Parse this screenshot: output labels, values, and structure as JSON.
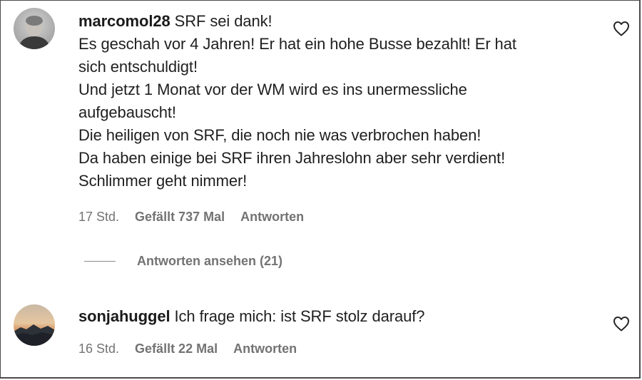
{
  "comments": [
    {
      "username": "marcomol28",
      "first_line": "SRF sei dank!",
      "lines": [
        "Es geschah vor 4 Jahren! Er hat ein hohe Busse bezahlt! Er hat",
        "sich entschuldigt!",
        "Und jetzt 1 Monat vor der WM wird es ins unermessliche",
        "aufgebauscht!",
        "Die heiligen von SRF, die noch nie was verbrochen haben!",
        "Da haben einige bei SRF ihren Jahreslohn aber sehr verdient!",
        "Schlimmer geht nimmer!"
      ],
      "time": "17 Std.",
      "likes": "Gefällt 737 Mal",
      "reply_label": "Antworten",
      "view_replies": "Antworten ansehen (21)",
      "like_icon": "heart-outline-icon"
    },
    {
      "username": "sonjahuggel",
      "first_line": "Ich frage mich: ist SRF stolz darauf?",
      "time": "16 Std.",
      "likes": "Gefällt 22 Mal",
      "reply_label": "Antworten",
      "like_icon": "heart-outline-icon"
    }
  ],
  "colors": {
    "text": "#1f1f1f",
    "secondary": "#737373",
    "border": "#4a4a4a"
  }
}
